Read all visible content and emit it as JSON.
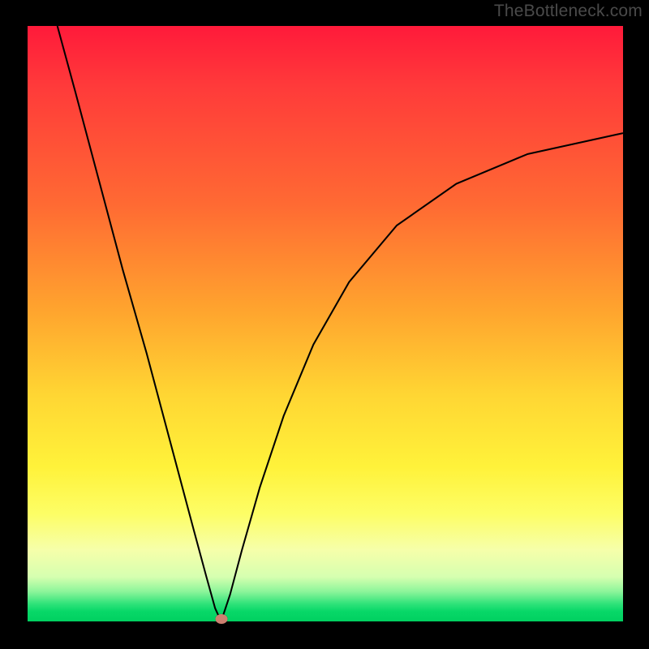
{
  "watermark": "TheBottleneck.com",
  "chart_data": {
    "type": "line",
    "title": "",
    "xlabel": "",
    "ylabel": "",
    "xlim": [
      0,
      100
    ],
    "ylim": [
      0,
      100
    ],
    "series": [
      {
        "name": "bottleneck-curve",
        "x": [
          5.0,
          8.0,
          12.0,
          16.0,
          20.0,
          24.0,
          28.0,
          30.0,
          31.5,
          32.5,
          34.0,
          36.0,
          39.0,
          43.0,
          48.0,
          54.0,
          62.0,
          72.0,
          84.0,
          100.0
        ],
        "values": [
          100.0,
          89.0,
          74.0,
          59.0,
          45.0,
          30.0,
          15.0,
          7.6,
          2.2,
          0.0,
          4.5,
          12.0,
          22.5,
          34.5,
          46.5,
          57.0,
          66.5,
          73.5,
          78.5,
          82.0
        ]
      }
    ],
    "marker": {
      "x": 32.5,
      "y": 0.0
    },
    "background_gradient": {
      "stops": [
        {
          "pos": 0.0,
          "color": "#ff1a3a"
        },
        {
          "pos": 0.3,
          "color": "#ff6a33"
        },
        {
          "pos": 0.62,
          "color": "#ffd633"
        },
        {
          "pos": 0.88,
          "color": "#f6ffaa"
        },
        {
          "pos": 1.0,
          "color": "#00d060"
        }
      ]
    },
    "annotations": []
  }
}
